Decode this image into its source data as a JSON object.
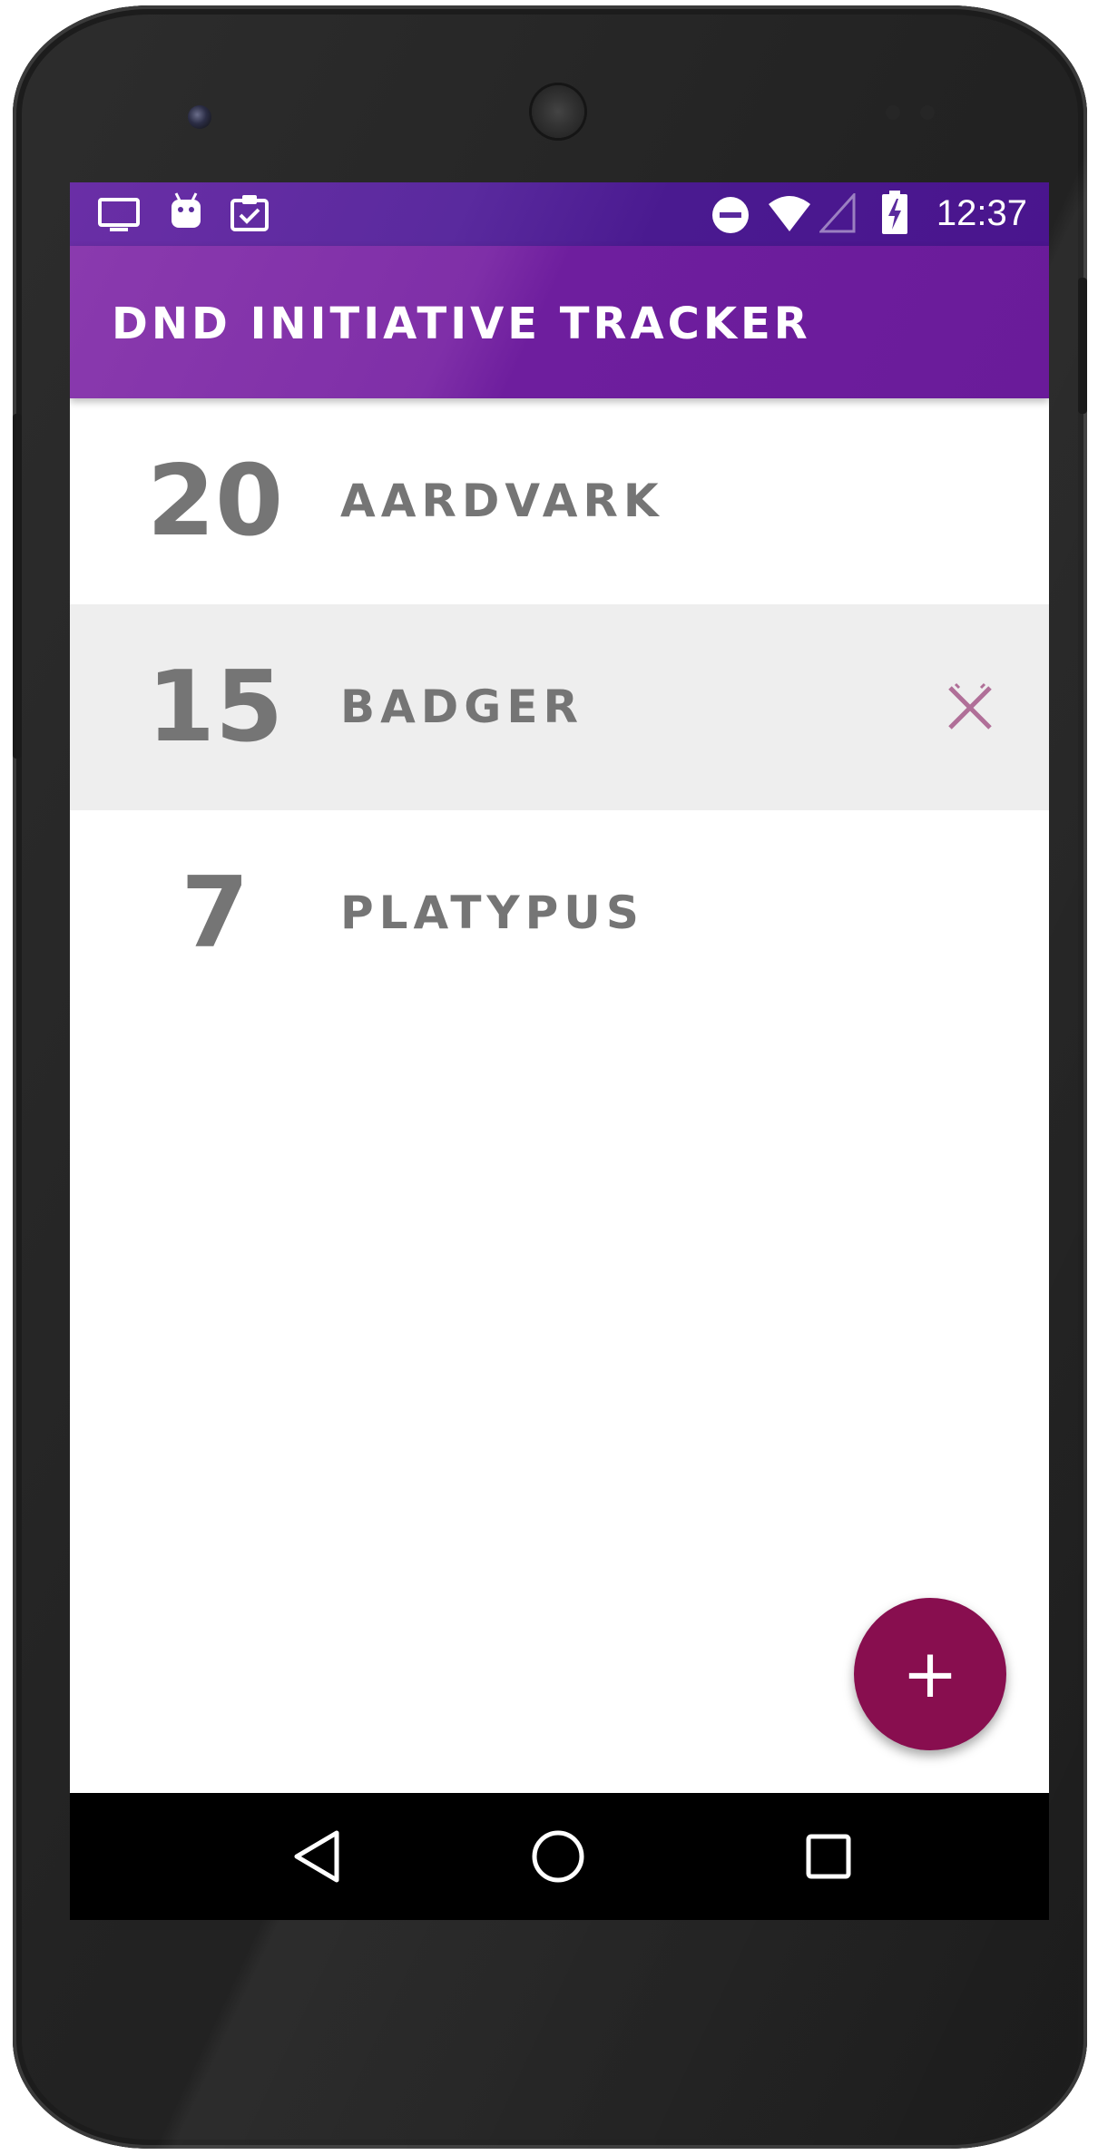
{
  "status_bar": {
    "time": "12:37",
    "left_icons": [
      "monitor-icon",
      "android-icon",
      "clipboard-check-icon"
    ],
    "right_icons": [
      "do-not-disturb-icon",
      "wifi-icon",
      "cell-signal-icon",
      "battery-charging-icon"
    ]
  },
  "app_bar": {
    "title": "DND INITIATIVE TRACKER",
    "color": "#6a1b9a"
  },
  "initiative_list": [
    {
      "score": "20",
      "name": "AARDVARK",
      "selected": false
    },
    {
      "score": "15",
      "name": "BADGER",
      "selected": true,
      "action_icon": "close-icon"
    },
    {
      "score": "7",
      "name": "PLATYPUS",
      "selected": false
    }
  ],
  "fab": {
    "label": "+",
    "icon": "add-icon",
    "color": "#880e4f"
  },
  "nav_bar": {
    "buttons": [
      "back-icon",
      "home-icon",
      "recents-icon"
    ]
  },
  "colors": {
    "text_gray": "#757575",
    "selected_row": "#eeeeee",
    "delete_icon": "#b06f98"
  }
}
